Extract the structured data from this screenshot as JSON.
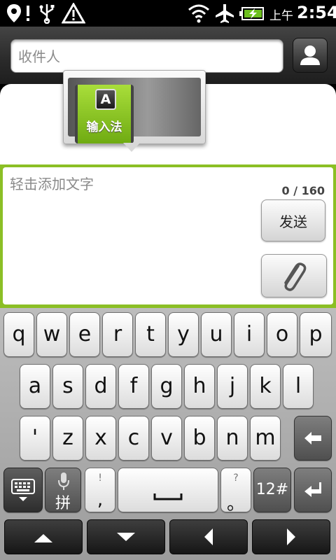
{
  "status_bar": {
    "ampm": "上午",
    "time": "2:54"
  },
  "compose": {
    "recipient_placeholder": "收件人",
    "message_placeholder": "轻击添加文字",
    "counter": "0 / 160",
    "send_label": "发送"
  },
  "ime_popup": {
    "key_letter": "A",
    "label": "输入法"
  },
  "keyboard": {
    "row1": [
      "q",
      "w",
      "e",
      "r",
      "t",
      "y",
      "u",
      "i",
      "o",
      "p"
    ],
    "row2": [
      "a",
      "s",
      "d",
      "f",
      "g",
      "h",
      "j",
      "k",
      "l"
    ],
    "row3": [
      "'",
      "z",
      "x",
      "c",
      "v",
      "b",
      "n",
      "m"
    ],
    "voice_key_label": "拼",
    "punct_left": {
      "top": "!",
      "bottom": ","
    },
    "punct_right": {
      "top": "?",
      "bottom": "。"
    },
    "num_key_label": "12#"
  },
  "colors": {
    "accent_green": "#8bbf25",
    "ime_green": "#8ecb26"
  },
  "icons": [
    "location-alert-icon",
    "usb-icon",
    "warning-icon",
    "wifi-icon",
    "airplane-icon",
    "battery-charging-icon",
    "contact-icon",
    "paperclip-icon",
    "keyboard-icon",
    "microphone-icon",
    "spacebar-icon",
    "backspace-icon",
    "enter-icon",
    "arrow-up-icon",
    "arrow-down-icon",
    "arrow-left-icon",
    "arrow-right-icon"
  ]
}
